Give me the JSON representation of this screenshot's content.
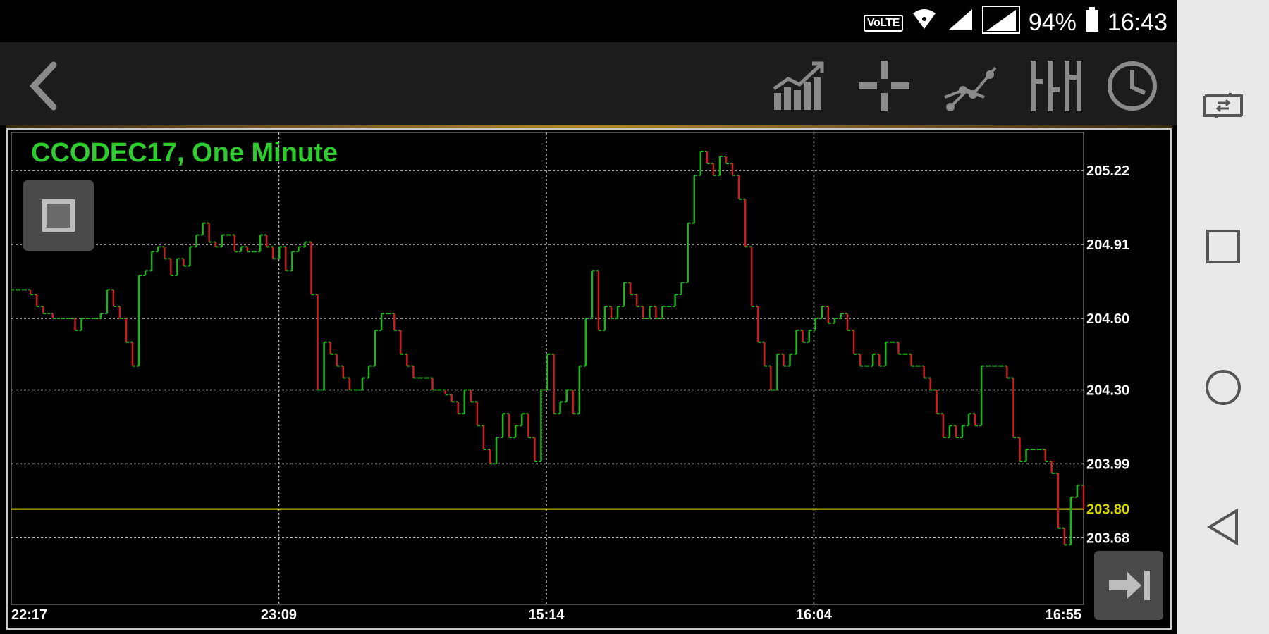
{
  "status_bar": {
    "volte": "VoLTE",
    "battery_percent": "94%",
    "time": "16:43",
    "icons": [
      "wifi-icon",
      "signal-icon",
      "signal-icon-2",
      "battery-icon"
    ]
  },
  "toolbar": {
    "back_icon": "chevron-left-icon",
    "tools": [
      "indicator-chart-icon",
      "crosshair-icon",
      "trendline-icon",
      "bar-type-icon",
      "clock-icon"
    ]
  },
  "chart": {
    "title": "CCODEC17, One Minute",
    "left_button_icon": "square-icon",
    "jump_button_icon": "jump-to-end-icon"
  },
  "navigation": {
    "icons": [
      "screen-switch-icon",
      "recents-square-icon",
      "home-circle-icon",
      "back-triangle-icon"
    ]
  },
  "colors": {
    "up": "#1fb21f",
    "down": "#c81e1e",
    "last_price": "#d8d800",
    "title": "#2ecc2e",
    "grid": "#bdbdbd"
  },
  "chart_data": {
    "type": "line",
    "title": "CCODEC17, One Minute",
    "y_axis_ticks": [
      205.22,
      204.91,
      204.6,
      204.3,
      203.99,
      203.68
    ],
    "y_axis_tick_labels": [
      "205.22",
      "204.91",
      "204.60",
      "204.30",
      "203.99",
      "203.68"
    ],
    "last_price": 203.8,
    "last_price_label": "203.80",
    "x_tick_labels": [
      "22:17",
      "23:09",
      "15:14",
      "16:04",
      "16:55"
    ],
    "ylim": [
      203.4,
      205.38
    ],
    "grid": true,
    "price_path": [
      [
        0,
        204.72
      ],
      [
        2,
        204.72
      ],
      [
        4,
        204.72
      ],
      [
        6,
        204.7
      ],
      [
        8,
        204.65
      ],
      [
        10,
        204.62
      ],
      [
        13,
        204.6
      ],
      [
        16,
        204.6
      ],
      [
        18,
        204.6
      ],
      [
        20,
        204.55
      ],
      [
        22,
        204.6
      ],
      [
        24,
        204.6
      ],
      [
        26,
        204.6
      ],
      [
        28,
        204.62
      ],
      [
        30,
        204.72
      ],
      [
        32,
        204.65
      ],
      [
        34,
        204.6
      ],
      [
        36,
        204.5
      ],
      [
        38,
        204.4
      ],
      [
        40,
        204.78
      ],
      [
        42,
        204.8
      ],
      [
        44,
        204.88
      ],
      [
        46,
        204.9
      ],
      [
        48,
        204.85
      ],
      [
        50,
        204.78
      ],
      [
        52,
        204.85
      ],
      [
        54,
        204.82
      ],
      [
        56,
        204.9
      ],
      [
        58,
        204.95
      ],
      [
        60,
        205.0
      ],
      [
        62,
        204.92
      ],
      [
        64,
        204.9
      ],
      [
        66,
        204.95
      ],
      [
        68,
        204.95
      ],
      [
        70,
        204.88
      ],
      [
        72,
        204.9
      ],
      [
        74,
        204.88
      ],
      [
        76,
        204.88
      ],
      [
        78,
        204.95
      ],
      [
        80,
        204.9
      ],
      [
        82,
        204.85
      ],
      [
        84,
        204.9
      ],
      [
        86,
        204.8
      ],
      [
        88,
        204.88
      ],
      [
        90,
        204.9
      ],
      [
        92,
        204.92
      ],
      [
        94,
        204.7
      ],
      [
        96,
        204.3
      ],
      [
        98,
        204.5
      ],
      [
        100,
        204.45
      ],
      [
        102,
        204.4
      ],
      [
        104,
        204.35
      ],
      [
        106,
        204.3
      ],
      [
        108,
        204.3
      ],
      [
        110,
        204.35
      ],
      [
        112,
        204.4
      ],
      [
        114,
        204.55
      ],
      [
        116,
        204.62
      ],
      [
        118,
        204.62
      ],
      [
        120,
        204.55
      ],
      [
        122,
        204.45
      ],
      [
        124,
        204.4
      ],
      [
        126,
        204.35
      ],
      [
        128,
        204.35
      ],
      [
        130,
        204.35
      ],
      [
        132,
        204.3
      ],
      [
        134,
        204.3
      ],
      [
        136,
        204.28
      ],
      [
        138,
        204.25
      ],
      [
        140,
        204.2
      ],
      [
        142,
        204.3
      ],
      [
        144,
        204.25
      ],
      [
        146,
        204.15
      ],
      [
        148,
        204.05
      ],
      [
        150,
        203.99
      ],
      [
        152,
        204.1
      ],
      [
        154,
        204.2
      ],
      [
        156,
        204.1
      ],
      [
        158,
        204.15
      ],
      [
        160,
        204.2
      ],
      [
        162,
        204.1
      ],
      [
        164,
        204.0
      ],
      [
        166,
        204.3
      ],
      [
        168,
        204.45
      ],
      [
        170,
        204.2
      ],
      [
        172,
        204.25
      ],
      [
        174,
        204.3
      ],
      [
        176,
        204.2
      ],
      [
        178,
        204.4
      ],
      [
        180,
        204.6
      ],
      [
        182,
        204.8
      ],
      [
        184,
        204.55
      ],
      [
        186,
        204.65
      ],
      [
        188,
        204.6
      ],
      [
        190,
        204.65
      ],
      [
        192,
        204.75
      ],
      [
        194,
        204.7
      ],
      [
        196,
        204.65
      ],
      [
        198,
        204.6
      ],
      [
        200,
        204.65
      ],
      [
        202,
        204.6
      ],
      [
        204,
        204.65
      ],
      [
        206,
        204.65
      ],
      [
        208,
        204.7
      ],
      [
        210,
        204.75
      ],
      [
        212,
        205.0
      ],
      [
        214,
        205.2
      ],
      [
        216,
        205.3
      ],
      [
        218,
        205.25
      ],
      [
        220,
        205.2
      ],
      [
        222,
        205.28
      ],
      [
        224,
        205.25
      ],
      [
        226,
        205.2
      ],
      [
        228,
        205.1
      ],
      [
        230,
        204.9
      ],
      [
        232,
        204.65
      ],
      [
        234,
        204.5
      ],
      [
        236,
        204.4
      ],
      [
        238,
        204.3
      ],
      [
        240,
        204.45
      ],
      [
        242,
        204.4
      ],
      [
        244,
        204.45
      ],
      [
        246,
        204.55
      ],
      [
        248,
        204.5
      ],
      [
        250,
        204.55
      ],
      [
        252,
        204.6
      ],
      [
        254,
        204.65
      ],
      [
        256,
        204.58
      ],
      [
        258,
        204.6
      ],
      [
        260,
        204.62
      ],
      [
        262,
        204.55
      ],
      [
        264,
        204.45
      ],
      [
        266,
        204.4
      ],
      [
        268,
        204.4
      ],
      [
        270,
        204.45
      ],
      [
        272,
        204.4
      ],
      [
        274,
        204.5
      ],
      [
        276,
        204.5
      ],
      [
        278,
        204.45
      ],
      [
        280,
        204.45
      ],
      [
        282,
        204.4
      ],
      [
        284,
        204.4
      ],
      [
        286,
        204.35
      ],
      [
        288,
        204.3
      ],
      [
        290,
        204.2
      ],
      [
        292,
        204.1
      ],
      [
        294,
        204.15
      ],
      [
        296,
        204.1
      ],
      [
        298,
        204.15
      ],
      [
        300,
        204.2
      ],
      [
        302,
        204.15
      ],
      [
        304,
        204.4
      ],
      [
        306,
        204.4
      ],
      [
        308,
        204.4
      ],
      [
        310,
        204.4
      ],
      [
        312,
        204.35
      ],
      [
        314,
        204.1
      ],
      [
        316,
        204.0
      ],
      [
        318,
        204.05
      ],
      [
        320,
        204.05
      ],
      [
        322,
        204.05
      ],
      [
        324,
        204.0
      ],
      [
        326,
        203.95
      ],
      [
        328,
        203.72
      ],
      [
        330,
        203.65
      ],
      [
        332,
        203.85
      ],
      [
        334,
        203.9
      ],
      [
        336,
        203.8
      ]
    ]
  }
}
